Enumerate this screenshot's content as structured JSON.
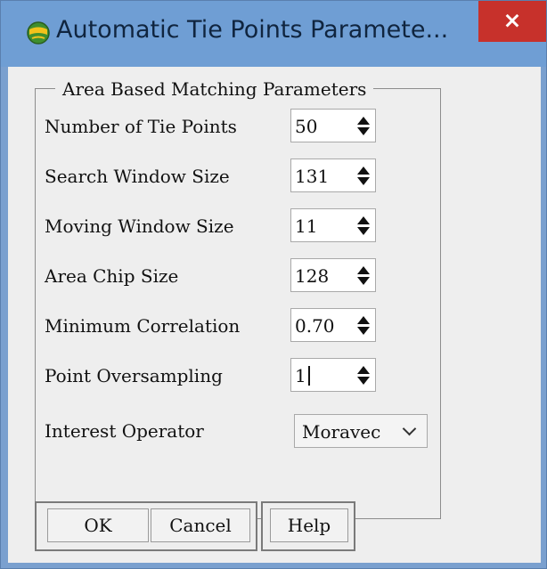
{
  "window": {
    "title": "Automatic Tie Points Paramete...",
    "close_label": "×"
  },
  "group": {
    "label": "Area Based Matching Parameters",
    "fields": [
      {
        "label": "Number of Tie Points",
        "value": "50"
      },
      {
        "label": "Search Window Size",
        "value": "131"
      },
      {
        "label": "Moving Window Size",
        "value": "11"
      },
      {
        "label": "Area Chip Size",
        "value": "128"
      },
      {
        "label": "Minimum Correlation",
        "value": "0.70"
      },
      {
        "label": "Point Oversampling",
        "value": "1"
      }
    ],
    "interest_operator": {
      "label": "Interest Operator",
      "value": "Moravec"
    }
  },
  "buttons": {
    "ok": "OK",
    "cancel": "Cancel",
    "help": "Help"
  },
  "colors": {
    "title_bar": "#6f9ed4",
    "close_button": "#c7312b",
    "dialog_background": "#eeeeee"
  },
  "icons": {
    "app": "globe-icon",
    "spinner": "up-down-arrows-icon",
    "dropdown": "chevron-down-icon"
  }
}
